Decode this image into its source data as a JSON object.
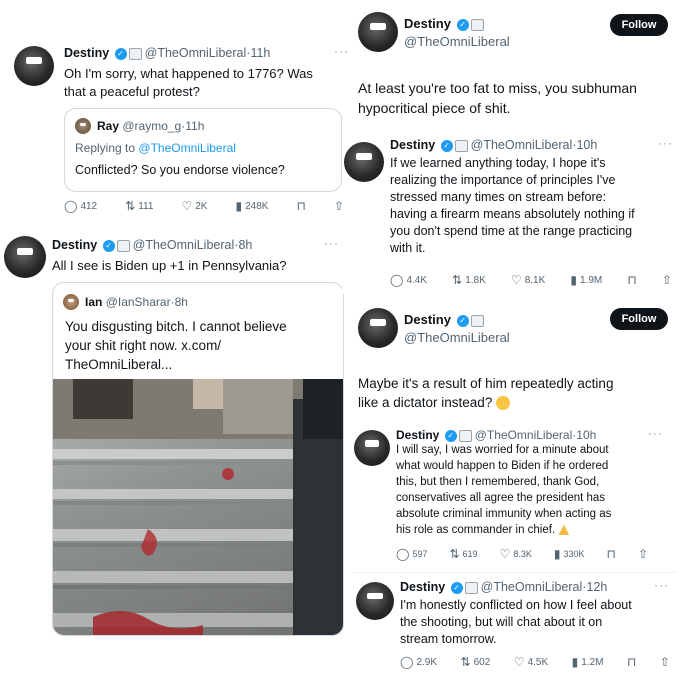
{
  "colors": {
    "accent": "#1d9bf0",
    "text": "#0f1419",
    "muted": "#536471",
    "border": "#cfd9de"
  },
  "icons": [
    "verified-badge-icon",
    "government-label-icon",
    "more-dots-icon",
    "reply-icon",
    "retweet-icon",
    "like-icon",
    "views-icon",
    "bookmark-icon",
    "share-icon",
    "thinking-emoji-icon",
    "praying-hands-emoji-icon"
  ],
  "t1": {
    "name": "Destiny",
    "handle": "@TheOmniLiberal",
    "time": "11h",
    "text1": "Oh I'm sorry, what happened to 1776? Was",
    "text2": "that a peaceful protest?",
    "quote": {
      "name": "Ray",
      "handle": "@raymo_g",
      "time": "11h",
      "replying": "Replying to",
      "replying_handle": "@TheOmniLiberal",
      "text": "Conflicted? So you endorse violence?"
    },
    "stats": {
      "reply": "412",
      "retweet": "111",
      "like": "2K",
      "views": "248K"
    }
  },
  "t2": {
    "name": "Destiny",
    "handle": "@TheOmniLiberal",
    "time": "8h",
    "text": "All I see is Biden up +1 in Pennsylvania?",
    "quote": {
      "name": "Ian",
      "handle": "@IanSharar",
      "time": "8h",
      "text1": "You disgusting bitch. I cannot believe",
      "text2": "your shit right now. x.com/",
      "text3": "TheOmniLiberal..."
    }
  },
  "t3": {
    "name": "Destiny",
    "handle": "@TheOmniLiberal",
    "follow": "Follow",
    "text1": "At least you're too fat to miss, you subhuman",
    "text2": "hypocritical piece of shit."
  },
  "t4": {
    "name": "Destiny",
    "handle": "@TheOmniLiberal",
    "time": "10h",
    "lines": [
      "If we learned anything today, I hope it's",
      "realizing the importance of principles I've",
      "stressed many times on stream before:",
      "having a firearm means absolutely nothing if",
      "you don't spend time at the range practicing",
      "with it."
    ],
    "stats": {
      "reply": "4.4K",
      "retweet": "1.8K",
      "like": "8.1K",
      "views": "1.9M"
    }
  },
  "t5": {
    "name": "Destiny",
    "handle": "@TheOmniLiberal",
    "follow": "Follow",
    "text1": "Maybe it's a result of him repeatedly acting",
    "text2": "like a dictator instead?"
  },
  "t6": {
    "name": "Destiny",
    "handle": "@TheOmniLiberal",
    "time": "10h",
    "lines": [
      "I will say, I was worried for a minute about",
      "what would happen to Biden if he ordered",
      "this, but then I remembered, thank God,",
      "conservatives all agree the president has",
      "absolute criminal immunity when acting as",
      "his role as commander in chief."
    ],
    "stats": {
      "reply": "597",
      "retweet": "619",
      "like": "8.3K",
      "views": "330K"
    }
  },
  "t7": {
    "name": "Destiny",
    "handle": "@TheOmniLiberal",
    "time": "12h",
    "lines": [
      "I'm honestly conflicted on how I feel about",
      "the shooting, but will chat about it on",
      "stream tomorrow."
    ],
    "stats": {
      "reply": "2.9K",
      "retweet": "602",
      "like": "4.5K",
      "views": "1.2M"
    }
  }
}
